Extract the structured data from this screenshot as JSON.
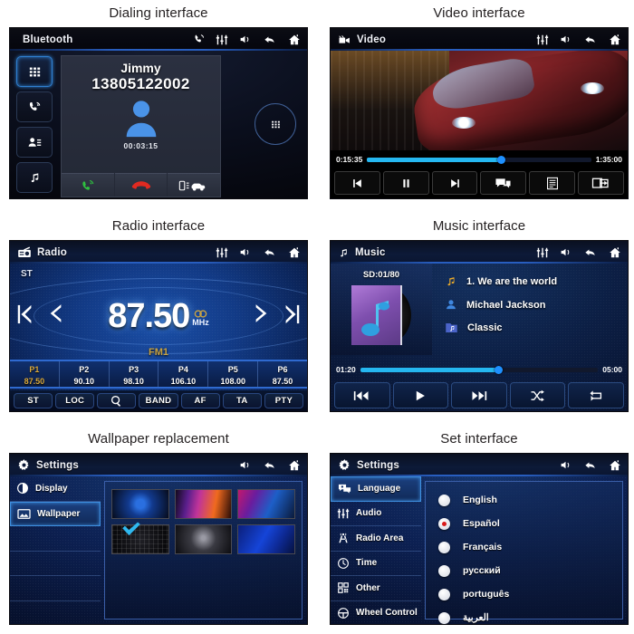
{
  "panels": {
    "dialing": {
      "caption": "Dialing interface",
      "header": {
        "title": "Bluetooth",
        "icons": [
          "phone-icon",
          "equalizer-icon",
          "volume-icon",
          "back-icon",
          "home-icon"
        ]
      },
      "sidebar": [
        "keypad-icon",
        "call-log-icon",
        "contacts-icon",
        "music-icon"
      ],
      "contact_name": "Jimmy",
      "contact_number": "13805122002",
      "call_timer": "00:03:15",
      "actions": [
        "answer-call-icon",
        "end-call-icon",
        "transfer-call-icon"
      ],
      "keypad_button": "keypad-icon"
    },
    "video": {
      "caption": "Video interface",
      "header": {
        "title": "Video",
        "icons": [
          "equalizer-icon",
          "volume-icon",
          "back-icon",
          "home-icon"
        ]
      },
      "elapsed": "0:15:35",
      "total": "1:35:00",
      "progress_percent": 60,
      "controls": [
        "previous-icon",
        "pause-icon",
        "next-icon",
        "subtitle-icon",
        "playlist-icon",
        "screen-share-icon"
      ]
    },
    "radio": {
      "caption": "Radio interface",
      "header": {
        "title": "Radio",
        "icons": [
          "equalizer-icon",
          "volume-icon",
          "back-icon",
          "home-icon"
        ]
      },
      "stereo_label": "ST",
      "frequency": "87.50",
      "unit": "MHz",
      "band": "FM1",
      "presets": [
        {
          "name": "P1",
          "freq": "87.50",
          "active": true
        },
        {
          "name": "P2",
          "freq": "90.10",
          "active": false
        },
        {
          "name": "P3",
          "freq": "98.10",
          "active": false
        },
        {
          "name": "P4",
          "freq": "106.10",
          "active": false
        },
        {
          "name": "P5",
          "freq": "108.00",
          "active": false
        },
        {
          "name": "P6",
          "freq": "87.50",
          "active": false
        }
      ],
      "buttons": [
        "ST",
        "LOC",
        "search-icon",
        "BAND",
        "AF",
        "TA",
        "PTY"
      ]
    },
    "music": {
      "caption": "Music interface",
      "header": {
        "title": "Music",
        "icons": [
          "equalizer-icon",
          "volume-icon",
          "back-icon",
          "home-icon"
        ]
      },
      "source": "SD:01/80",
      "track": "1.  We are the world",
      "artist": "Michael Jackson",
      "genre": "Classic",
      "elapsed": "01:20",
      "total": "05:00",
      "progress_percent": 58,
      "controls": [
        "previous-track-icon",
        "play-icon",
        "next-track-icon",
        "shuffle-icon",
        "repeat-icon"
      ]
    },
    "wallpaper": {
      "caption": "Wallpaper replacement",
      "header": {
        "title": "Settings",
        "icons": [
          "volume-icon",
          "back-icon",
          "home-icon"
        ]
      },
      "sidebar": [
        {
          "label": "Display",
          "icon": "contrast-icon",
          "active": false
        },
        {
          "label": "Wallpaper",
          "icon": "image-icon",
          "active": true
        },
        {
          "label": "",
          "icon": "",
          "active": false
        },
        {
          "label": "",
          "icon": "",
          "active": false
        },
        {
          "label": "",
          "icon": "",
          "active": false
        },
        {
          "label": "",
          "icon": "",
          "active": false
        }
      ],
      "thumbnails": [
        {
          "id": "wp1",
          "selected": true
        },
        {
          "id": "wp2",
          "selected": false
        },
        {
          "id": "wp3",
          "selected": false
        },
        {
          "id": "wp4",
          "selected": false
        },
        {
          "id": "wp5",
          "selected": false
        },
        {
          "id": "wp6",
          "selected": false
        }
      ]
    },
    "settings": {
      "caption": "Set interface",
      "header": {
        "title": "Settings",
        "icons": [
          "volume-icon",
          "back-icon",
          "home-icon"
        ]
      },
      "sidebar": [
        {
          "label": "Language",
          "icon": "speech-bubble-icon",
          "active": true
        },
        {
          "label": "Audio",
          "icon": "equalizer-icon",
          "active": false
        },
        {
          "label": "Radio Area",
          "icon": "antenna-icon",
          "active": false
        },
        {
          "label": "Time",
          "icon": "clock-icon",
          "active": false
        },
        {
          "label": "Other",
          "icon": "grid-blocks-icon",
          "active": false
        },
        {
          "label": "Wheel Control",
          "icon": "steering-wheel-icon",
          "active": false
        }
      ],
      "languages": [
        {
          "label": "English",
          "selected": false
        },
        {
          "label": "Español",
          "selected": true
        },
        {
          "label": "Français",
          "selected": false
        },
        {
          "label": "русский",
          "selected": false
        },
        {
          "label": "português",
          "selected": false
        },
        {
          "label": "العربية",
          "selected": false
        }
      ]
    }
  },
  "colors": {
    "accent_blue": "#2f7fd0",
    "progress_cyan": "#25b7f0",
    "preset_gold": "#d8a93f",
    "radio_red": "#d81b1b",
    "answer_green": "#2fbf3f",
    "end_red": "#e02a21"
  }
}
